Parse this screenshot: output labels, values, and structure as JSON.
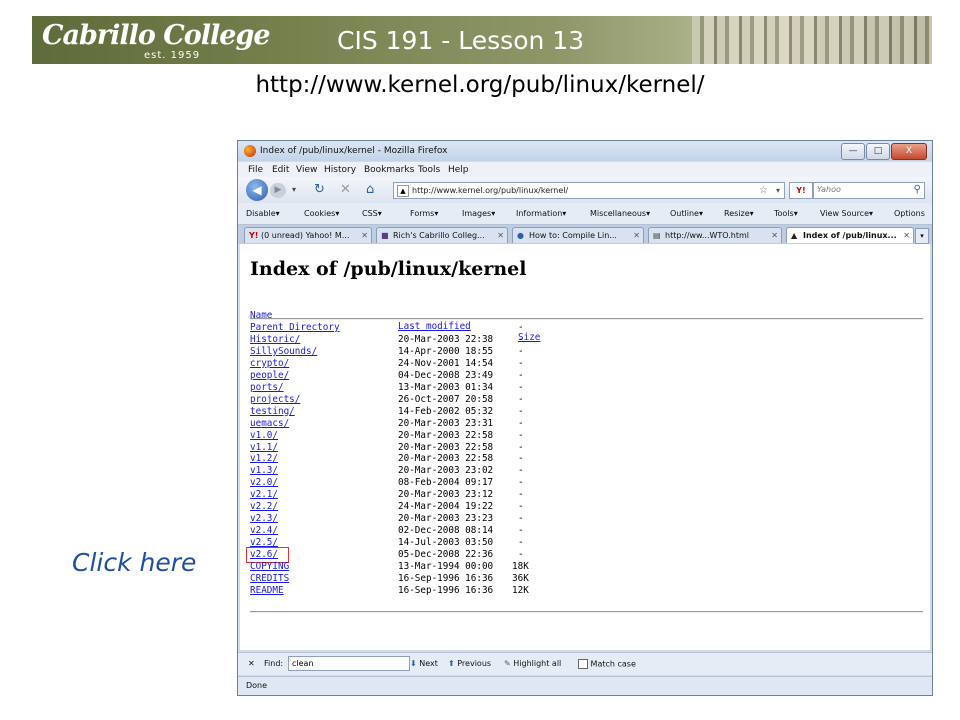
{
  "slide": {
    "logo_text": "Cabrillo College",
    "logo_est": "est. 1959",
    "title": "CIS 191 - Lesson 13",
    "url_heading": "http://www.kernel.org/pub/linux/kernel/",
    "callout": "Click here"
  },
  "window": {
    "title": "Index of /pub/linux/kernel - Mozilla Firefox",
    "controls": {
      "minimize": "—",
      "maximize": "□",
      "close": "X"
    }
  },
  "menu": [
    "File",
    "Edit",
    "View",
    "History",
    "Bookmarks",
    "Tools",
    "Help"
  ],
  "nav": {
    "address": "http://www.kernel.org/pub/linux/kernel/",
    "search_placeholder": "Yahoo",
    "search_engine_label": "Y!"
  },
  "devtoolbar": [
    "Disable▾",
    "Cookies▾",
    "CSS▾",
    "Forms▾",
    "Images▾",
    "Information▾",
    "Miscellaneous▾",
    "Outline▾",
    "Resize▾",
    "Tools▾",
    "View Source▾",
    "Options"
  ],
  "tabs": [
    {
      "label": "(0 unread) Yahoo! M...",
      "icon": "Y!",
      "active": false
    },
    {
      "label": "Rich's Cabrillo Colleg...",
      "icon": "■",
      "active": false
    },
    {
      "label": "How to: Compile Lin...",
      "icon": "●",
      "active": false
    },
    {
      "label": "http://ww...WTO.html",
      "icon": "▤",
      "active": false
    },
    {
      "label": "Index of /pub/linux...",
      "icon": "▲",
      "active": true
    }
  ],
  "page": {
    "heading": "Index of /pub/linux/kernel",
    "columns": {
      "name": "Name",
      "modified": "Last modified",
      "size": "Size"
    },
    "rows": [
      {
        "name": "Parent Directory",
        "modified": "",
        "size": "-"
      },
      {
        "name": "Historic/",
        "modified": "20-Mar-2003 22:38",
        "size": "-"
      },
      {
        "name": "SillySounds/",
        "modified": "14-Apr-2000 18:55",
        "size": "-"
      },
      {
        "name": "crypto/",
        "modified": "24-Nov-2001 14:54",
        "size": "-"
      },
      {
        "name": "people/",
        "modified": "04-Dec-2008 23:49",
        "size": "-"
      },
      {
        "name": "ports/",
        "modified": "13-Mar-2003 01:34",
        "size": "-"
      },
      {
        "name": "projects/",
        "modified": "26-Oct-2007 20:58",
        "size": "-"
      },
      {
        "name": "testing/",
        "modified": "14-Feb-2002 05:32",
        "size": "-"
      },
      {
        "name": "uemacs/",
        "modified": "20-Mar-2003 23:31",
        "size": "-"
      },
      {
        "name": "v1.0/",
        "modified": "20-Mar-2003 22:58",
        "size": "-"
      },
      {
        "name": "v1.1/",
        "modified": "20-Mar-2003 22:58",
        "size": "-"
      },
      {
        "name": "v1.2/",
        "modified": "20-Mar-2003 22:58",
        "size": "-"
      },
      {
        "name": "v1.3/",
        "modified": "20-Mar-2003 23:02",
        "size": "-"
      },
      {
        "name": "v2.0/",
        "modified": "08-Feb-2004 09:17",
        "size": "-"
      },
      {
        "name": "v2.1/",
        "modified": "20-Mar-2003 23:12",
        "size": "-"
      },
      {
        "name": "v2.2/",
        "modified": "24-Mar-2004 19:22",
        "size": "-"
      },
      {
        "name": "v2.3/",
        "modified": "20-Mar-2003 23:23",
        "size": "-"
      },
      {
        "name": "v2.4/",
        "modified": "02-Dec-2008 08:14",
        "size": "-"
      },
      {
        "name": "v2.5/",
        "modified": "14-Jul-2003 03:50",
        "size": "-"
      },
      {
        "name": "v2.6/",
        "modified": "05-Dec-2008 22:36",
        "size": "-",
        "highlighted": true
      },
      {
        "name": "COPYING",
        "modified": "13-Mar-1994 00:00",
        "size": "18K"
      },
      {
        "name": "CREDITS",
        "modified": "16-Sep-1996 16:36",
        "size": "36K"
      },
      {
        "name": "README",
        "modified": "16-Sep-1996 16:36",
        "size": "12K"
      }
    ]
  },
  "findbar": {
    "close": "✕",
    "label": "Find:",
    "value": "clean",
    "next": "Next",
    "previous": "Previous",
    "highlight_all": "Highlight all",
    "match_case": "Match case"
  },
  "status": "Done",
  "colors": {
    "link": "#1a1ae6",
    "callout": "#1f4fa0",
    "highlight_box": "#e0303a"
  }
}
